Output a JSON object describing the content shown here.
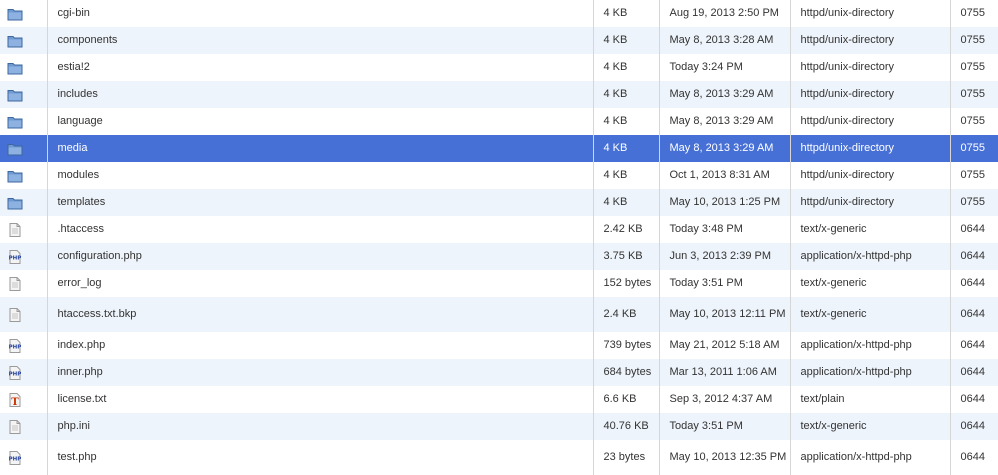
{
  "colors": {
    "selected_row": "#4770d6",
    "alt_row": "#eef4fb",
    "folder": "#6f9ad2",
    "php_text": "#1f3f9b",
    "text_icon_t": "#cc3300"
  },
  "files": [
    {
      "icon": "folder-icon",
      "name": "cgi-bin",
      "size": "4 KB",
      "modified": "Aug 19, 2013 2:50 PM",
      "type": "httpd/unix-directory",
      "perms": "0755"
    },
    {
      "icon": "folder-icon",
      "name": "components",
      "size": "4 KB",
      "modified": "May 8, 2013 3:28 AM",
      "type": "httpd/unix-directory",
      "perms": "0755"
    },
    {
      "icon": "folder-icon",
      "name": "estia!2",
      "size": "4 KB",
      "modified": "Today 3:24 PM",
      "type": "httpd/unix-directory",
      "perms": "0755"
    },
    {
      "icon": "folder-icon",
      "name": "includes",
      "size": "4 KB",
      "modified": "May 8, 2013 3:29 AM",
      "type": "httpd/unix-directory",
      "perms": "0755"
    },
    {
      "icon": "folder-icon",
      "name": "language",
      "size": "4 KB",
      "modified": "May 8, 2013 3:29 AM",
      "type": "httpd/unix-directory",
      "perms": "0755"
    },
    {
      "icon": "folder-icon",
      "name": "media",
      "size": "4 KB",
      "modified": "May 8, 2013 3:29 AM",
      "type": "httpd/unix-directory",
      "perms": "0755"
    },
    {
      "icon": "folder-icon",
      "name": "modules",
      "size": "4 KB",
      "modified": "Oct 1, 2013 8:31 AM",
      "type": "httpd/unix-directory",
      "perms": "0755"
    },
    {
      "icon": "folder-icon",
      "name": "templates",
      "size": "4 KB",
      "modified": "May 10, 2013 1:25 PM",
      "type": "httpd/unix-directory",
      "perms": "0755"
    },
    {
      "icon": "generic-file-icon",
      "name": ".htaccess",
      "size": "2.42 KB",
      "modified": "Today 3:48 PM",
      "type": "text/x-generic",
      "perms": "0644"
    },
    {
      "icon": "php-file-icon",
      "name": "configuration.php",
      "size": "3.75 KB",
      "modified": "Jun 3, 2013 2:39 PM",
      "type": "application/x-httpd-php",
      "perms": "0644"
    },
    {
      "icon": "generic-file-icon",
      "name": "error_log",
      "size": "152 bytes",
      "modified": "Today 3:51 PM",
      "type": "text/x-generic",
      "perms": "0644"
    },
    {
      "icon": "generic-file-icon",
      "name": "htaccess.txt.bkp",
      "size": "2.4 KB",
      "modified": "May 10, 2013 12:11 PM",
      "type": "text/x-generic",
      "perms": "0644"
    },
    {
      "icon": "php-file-icon",
      "name": "index.php",
      "size": "739 bytes",
      "modified": "May 21, 2012 5:18 AM",
      "type": "application/x-httpd-php",
      "perms": "0644"
    },
    {
      "icon": "php-file-icon",
      "name": "inner.php",
      "size": "684 bytes",
      "modified": "Mar 13, 2011 1:06 AM",
      "type": "application/x-httpd-php",
      "perms": "0644"
    },
    {
      "icon": "text-file-icon",
      "name": "license.txt",
      "size": "6.6 KB",
      "modified": "Sep 3, 2012 4:37 AM",
      "type": "text/plain",
      "perms": "0644"
    },
    {
      "icon": "generic-file-icon",
      "name": "php.ini",
      "size": "40.76 KB",
      "modified": "Today 3:51 PM",
      "type": "text/x-generic",
      "perms": "0644"
    },
    {
      "icon": "php-file-icon",
      "name": "test.php",
      "size": "23 bytes",
      "modified": "May 10, 2013 12:35 PM",
      "type": "application/x-httpd-php",
      "perms": "0644"
    }
  ]
}
